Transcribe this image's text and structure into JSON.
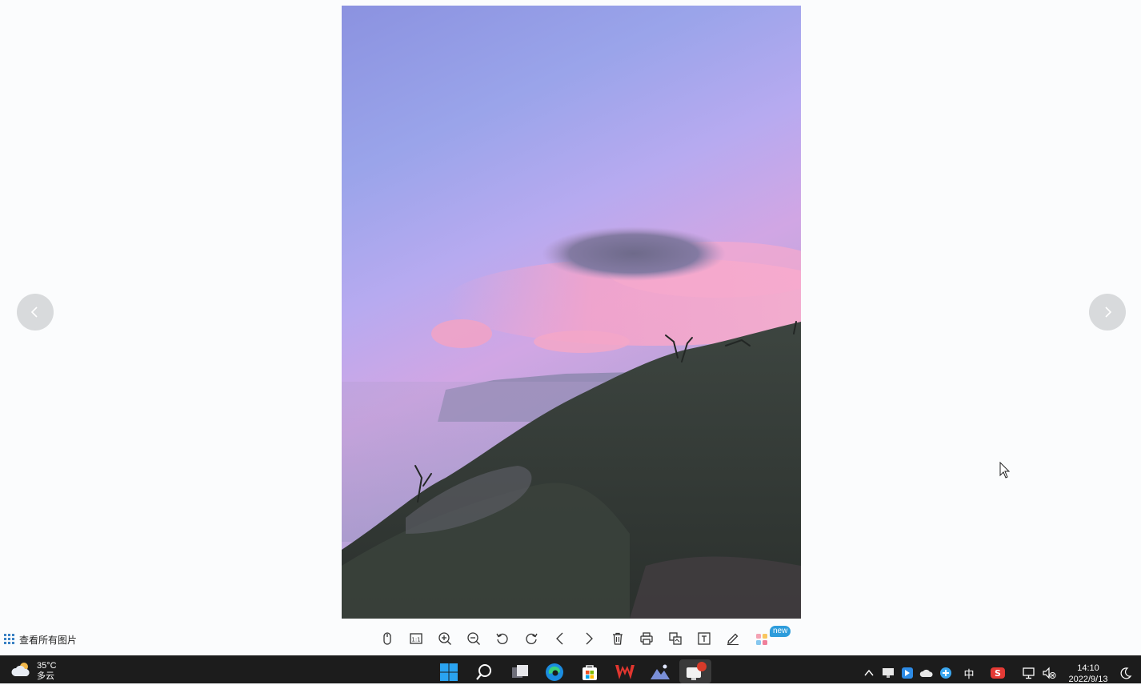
{
  "viewer": {
    "view_all_label": "查看所有图片",
    "new_badge": "new",
    "toolbar_tools": [
      "mouse-mode",
      "actual-size",
      "zoom-in",
      "zoom-out",
      "rotate-left",
      "rotate-right",
      "previous",
      "next",
      "delete",
      "print",
      "convert",
      "extract-text",
      "edit",
      "more-apps"
    ]
  },
  "taskbar": {
    "weather": {
      "temperature": "35°C",
      "condition": "多云"
    },
    "input_method": "中",
    "clock": {
      "time": "14:10",
      "date": "2022/9/13"
    }
  },
  "colors": {
    "taskbar_bg": "#1c1c1c",
    "viewer_bg": "#fbfcfd",
    "badge": "#2d9cdb",
    "sky_top": "#8e95e2",
    "sky_pink": "#f0a0c8"
  }
}
